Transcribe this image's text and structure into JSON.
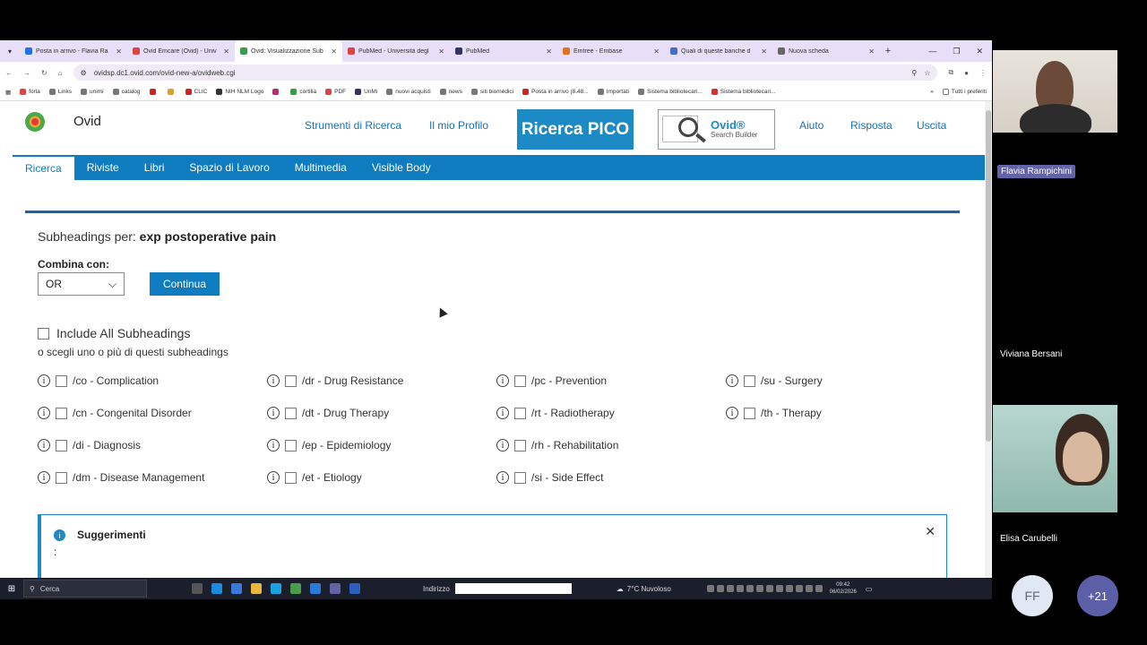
{
  "browser": {
    "tabs": [
      {
        "label": "Posta in arrivo - Flavia Ra",
        "color": "#1a73e8",
        "active": false
      },
      {
        "label": "Ovid Emcare (Ovid) - Univ",
        "color": "#d44",
        "active": false
      },
      {
        "label": "Ovid: Visualizzazione Sub",
        "color": "#3a9b4a",
        "active": true
      },
      {
        "label": "PubMed - Università degl",
        "color": "#d44",
        "active": false
      },
      {
        "label": "PubMed",
        "color": "#336",
        "active": false
      },
      {
        "label": "Emtree - Embase",
        "color": "#e07020",
        "active": false
      },
      {
        "label": "Quali di queste banche d",
        "color": "#4a6ac8",
        "active": false
      },
      {
        "label": "Nuova scheda",
        "color": "#666",
        "active": false
      }
    ],
    "url": "ovidsp.dc1.ovid.com/ovid-new-a/ovidweb.cgi",
    "bookmarks": [
      "forla",
      "Links",
      "unimi",
      "catalog",
      "",
      "",
      "CLIC",
      "NIH NLM Logo",
      "",
      "cortilia",
      "PDF",
      "UnMi",
      "nuovi acquisti",
      "news",
      "siti biomedici",
      "Posta in arrivo (8.48...",
      "Importati",
      "Sistema bibliotecari...",
      "Sistema bibliotecari..."
    ],
    "bookmarks_right": "Tutti i preferiti"
  },
  "ovid": {
    "logo": "Ovid",
    "top_links": [
      "Strumenti di Ricerca",
      "Il mio Profilo",
      "Aiuto",
      "Risposta",
      "Uscita"
    ],
    "pico_label": "Ricerca PICO",
    "builder_title": "Ovid®",
    "builder_sub": "Search Builder",
    "nav": [
      "Ricerca",
      "Riviste",
      "Libri",
      "Spazio di Lavoro",
      "Multimedia",
      "Visible Body"
    ],
    "subheadings_prefix": "Subheadings per:",
    "subheadings_term": "exp postoperative pain",
    "combina_label": "Combina con:",
    "combina_value": "OR",
    "continua_label": "Continua",
    "include_all": "Include All Subheadings",
    "scegli": "o scegli uno o più di questi subheadings",
    "subheadings": [
      [
        "/co - Complication",
        "/cn - Congenital Disorder",
        "/di - Diagnosis",
        "/dm - Disease Management"
      ],
      [
        "/dr - Drug Resistance",
        "/dt - Drug Therapy",
        "/ep - Epidemiology",
        "/et - Etiology"
      ],
      [
        "/pc - Prevention",
        "/rt - Radiotherapy",
        "/rh - Rehabilitation",
        "/si - Side Effect"
      ],
      [
        "/su - Surgery",
        "/th - Therapy"
      ]
    ],
    "suggestions_title": "Suggerimenti",
    "suggestions_colon": ":"
  },
  "taskbar": {
    "search": "Cerca",
    "address_label": "Indirizzo",
    "weather": "7°C  Nuvoloso",
    "time": "09:42",
    "date": "06/02/2026"
  },
  "meeting": {
    "participants": [
      "Flavia Rampichini",
      "Viviana Bersani",
      "Elisa Carubelli"
    ],
    "avatar_initials": "FF",
    "more_count": "+21"
  }
}
